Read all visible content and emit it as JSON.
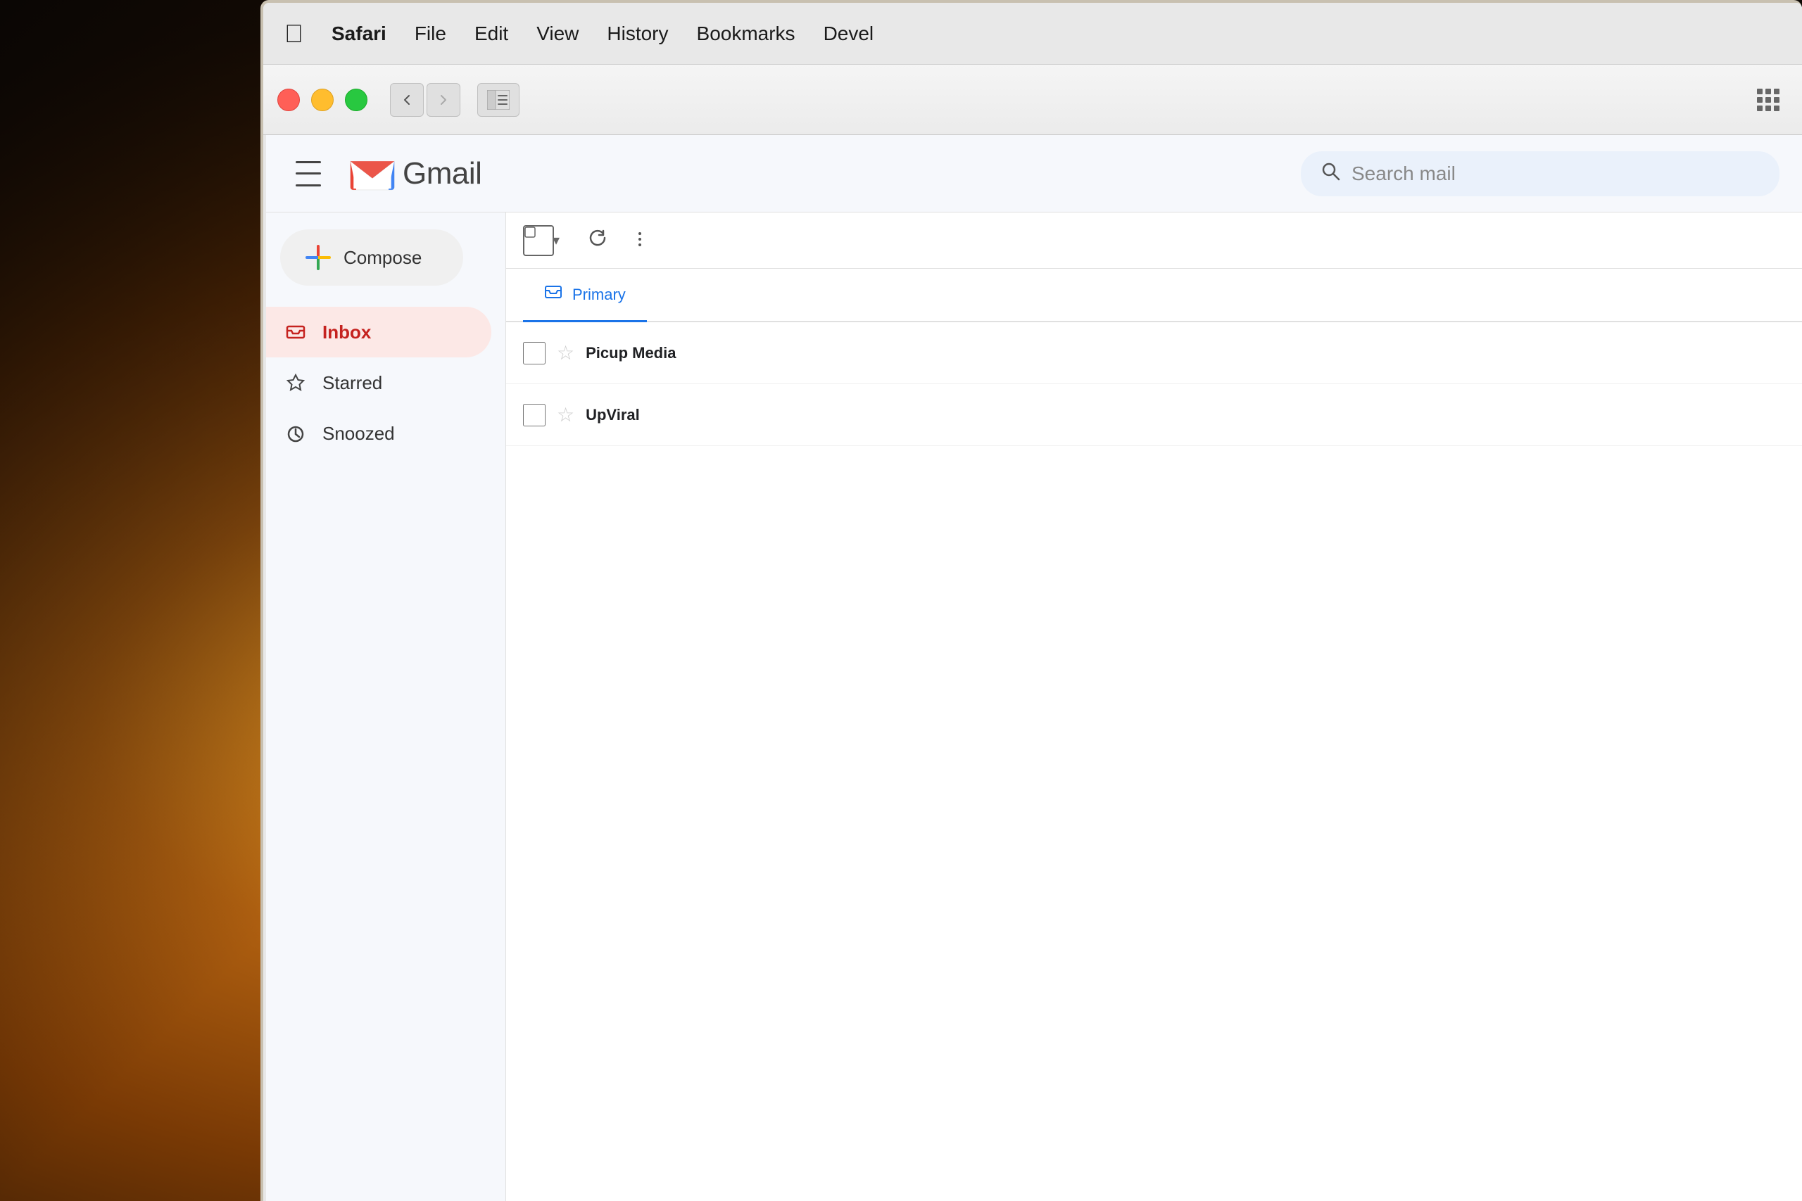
{
  "background": {
    "description": "warm bokeh background with glowing light"
  },
  "macos": {
    "menu_bar": {
      "apple_symbol": "&#63743;",
      "items": [
        {
          "label": "Safari",
          "bold": true
        },
        {
          "label": "File",
          "bold": false
        },
        {
          "label": "Edit",
          "bold": false
        },
        {
          "label": "View",
          "bold": false
        },
        {
          "label": "History",
          "bold": false
        },
        {
          "label": "Bookmarks",
          "bold": false
        },
        {
          "label": "Devel",
          "bold": false
        }
      ]
    },
    "toolbar": {
      "back_label": "‹",
      "forward_label": "›",
      "sidebar_toggle_label": "sidebar"
    }
  },
  "gmail": {
    "header": {
      "menu_label": "menu",
      "logo_text": "Gmail",
      "search_placeholder": "Search mail"
    },
    "compose_button_label": "Compose",
    "nav_items": [
      {
        "id": "inbox",
        "label": "Inbox",
        "active": true,
        "icon": "inbox"
      },
      {
        "id": "starred",
        "label": "Starred",
        "active": false,
        "icon": "star"
      },
      {
        "id": "snoozed",
        "label": "Snoozed",
        "active": false,
        "icon": "clock"
      }
    ],
    "email_list": {
      "toolbar": {
        "select_label": "select",
        "refresh_label": "refresh",
        "more_label": "more"
      },
      "tabs": [
        {
          "id": "primary",
          "label": "Primary",
          "active": true,
          "icon": "inbox"
        }
      ],
      "emails": [
        {
          "sender": "Picup Media",
          "preview": "",
          "star": false
        },
        {
          "sender": "UpViral",
          "preview": "",
          "star": false
        }
      ]
    }
  }
}
